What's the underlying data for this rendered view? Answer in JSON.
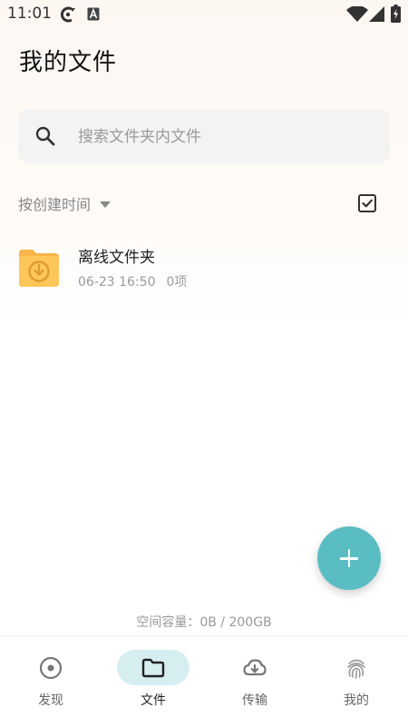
{
  "status_bar": {
    "time": "11:01",
    "left_icons": [
      "sync-icon",
      "a-badge-icon"
    ],
    "right_icons": [
      "wifi-icon",
      "signal-icon",
      "battery-icon"
    ]
  },
  "header": {
    "title": "我的文件"
  },
  "search": {
    "placeholder": "搜索文件夹内文件",
    "value": ""
  },
  "toolbar": {
    "sort_label": "按创建时间",
    "sort_icon": "caret-down-icon",
    "select_icon": "checkbox-icon"
  },
  "files": [
    {
      "name": "离线文件夹",
      "date": "06-23 16:50",
      "count": "0项",
      "icon": "offline-folder-icon"
    }
  ],
  "fab": {
    "icon": "plus-icon"
  },
  "storage": {
    "text": "空间容量：0B / 200GB"
  },
  "tabs": [
    {
      "label": "发现",
      "icon": "discover-icon",
      "active": false
    },
    {
      "label": "文件",
      "icon": "folder-icon",
      "active": true
    },
    {
      "label": "传输",
      "icon": "cloud-download-icon",
      "active": false
    },
    {
      "label": "我的",
      "icon": "fingerprint-icon",
      "active": false
    }
  ],
  "colors": {
    "accent": "#5bbdc4",
    "active_tab_bg": "#d6eef0",
    "folder": "#ffc65a"
  }
}
